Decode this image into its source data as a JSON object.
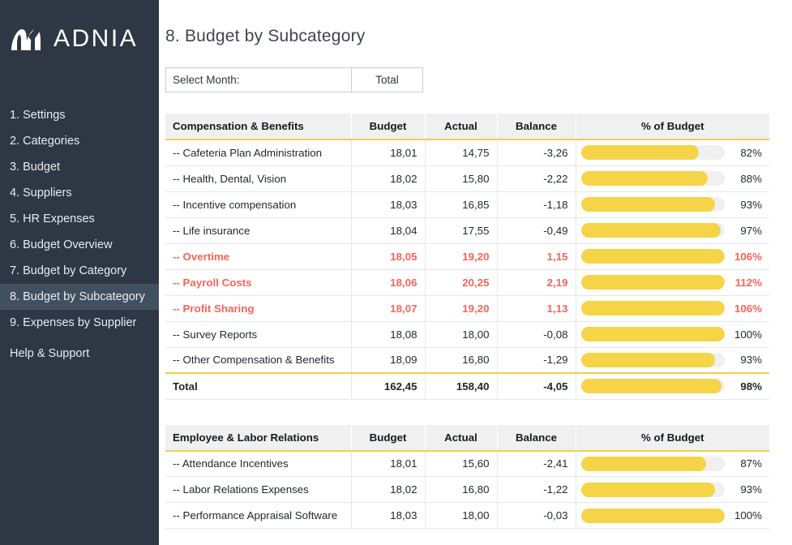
{
  "brand": {
    "name_bold": "ADN",
    "name_thin": "IA",
    "logo_icon": "adnia-logo-icon"
  },
  "sidebar": {
    "items": [
      {
        "label": "1. Settings",
        "active": false
      },
      {
        "label": "2. Categories",
        "active": false
      },
      {
        "label": "3. Budget",
        "active": false
      },
      {
        "label": "4. Suppliers",
        "active": false
      },
      {
        "label": "5. HR Expenses",
        "active": false
      },
      {
        "label": "6. Budget Overview",
        "active": false
      },
      {
        "label": "7. Budget by Category",
        "active": false
      },
      {
        "label": "8. Budget by Subcategory",
        "active": true
      },
      {
        "label": "9. Expenses by Supplier",
        "active": false
      },
      {
        "label": "Help & Support",
        "active": false
      }
    ]
  },
  "header": {
    "title": "8. Budget by Subcategory"
  },
  "month_selector": {
    "label": "Select Month:",
    "value": "Total"
  },
  "colors": {
    "sidebar_bg": "#2e3744",
    "sidebar_active": "#41505f",
    "accent_yellow": "#f2ce4c",
    "bar_fill": "#f5d447",
    "bar_track": "#f0f0f0",
    "over_budget_red": "#f4645a",
    "header_bg": "#f0f0f0"
  },
  "columns": [
    "Budget",
    "Actual",
    "Balance",
    "% of Budget"
  ],
  "tables": [
    {
      "name": "Compensation & Benefits",
      "rows": [
        {
          "name": "-- Cafeteria Plan Administration",
          "budget": "18,01",
          "actual": "14,75",
          "balance": "-3,26",
          "pct": "82%",
          "pct_value": 82,
          "over": false
        },
        {
          "name": "-- Health, Dental, Vision",
          "budget": "18,02",
          "actual": "15,80",
          "balance": "-2,22",
          "pct": "88%",
          "pct_value": 88,
          "over": false
        },
        {
          "name": "-- Incentive compensation",
          "budget": "18,03",
          "actual": "16,85",
          "balance": "-1,18",
          "pct": "93%",
          "pct_value": 93,
          "over": false
        },
        {
          "name": "-- Life insurance",
          "budget": "18,04",
          "actual": "17,55",
          "balance": "-0,49",
          "pct": "97%",
          "pct_value": 97,
          "over": false
        },
        {
          "name": "-- Overtime",
          "budget": "18,05",
          "actual": "19,20",
          "balance": "1,15",
          "pct": "106%",
          "pct_value": 106,
          "over": true
        },
        {
          "name": "-- Payroll Costs",
          "budget": "18,06",
          "actual": "20,25",
          "balance": "2,19",
          "pct": "112%",
          "pct_value": 112,
          "over": true
        },
        {
          "name": "-- Profit Sharing",
          "budget": "18,07",
          "actual": "19,20",
          "balance": "1,13",
          "pct": "106%",
          "pct_value": 106,
          "over": true
        },
        {
          "name": "-- Survey Reports",
          "budget": "18,08",
          "actual": "18,00",
          "balance": "-0,08",
          "pct": "100%",
          "pct_value": 100,
          "over": false
        },
        {
          "name": "-- Other Compensation & Benefits",
          "budget": "18,09",
          "actual": "16,80",
          "balance": "-1,29",
          "pct": "93%",
          "pct_value": 93,
          "over": false
        }
      ],
      "total": {
        "name": "Total",
        "budget": "162,45",
        "actual": "158,40",
        "balance": "-4,05",
        "pct": "98%",
        "pct_value": 98
      }
    },
    {
      "name": "Employee & Labor Relations",
      "rows": [
        {
          "name": "-- Attendance Incentives",
          "budget": "18,01",
          "actual": "15,60",
          "balance": "-2,41",
          "pct": "87%",
          "pct_value": 87,
          "over": false
        },
        {
          "name": "-- Labor Relations Expenses",
          "budget": "18,02",
          "actual": "16,80",
          "balance": "-1,22",
          "pct": "93%",
          "pct_value": 93,
          "over": false
        },
        {
          "name": "-- Performance Appraisal Software",
          "budget": "18,03",
          "actual": "18,00",
          "balance": "-0,03",
          "pct": "100%",
          "pct_value": 100,
          "over": false
        }
      ],
      "total": null
    }
  ]
}
